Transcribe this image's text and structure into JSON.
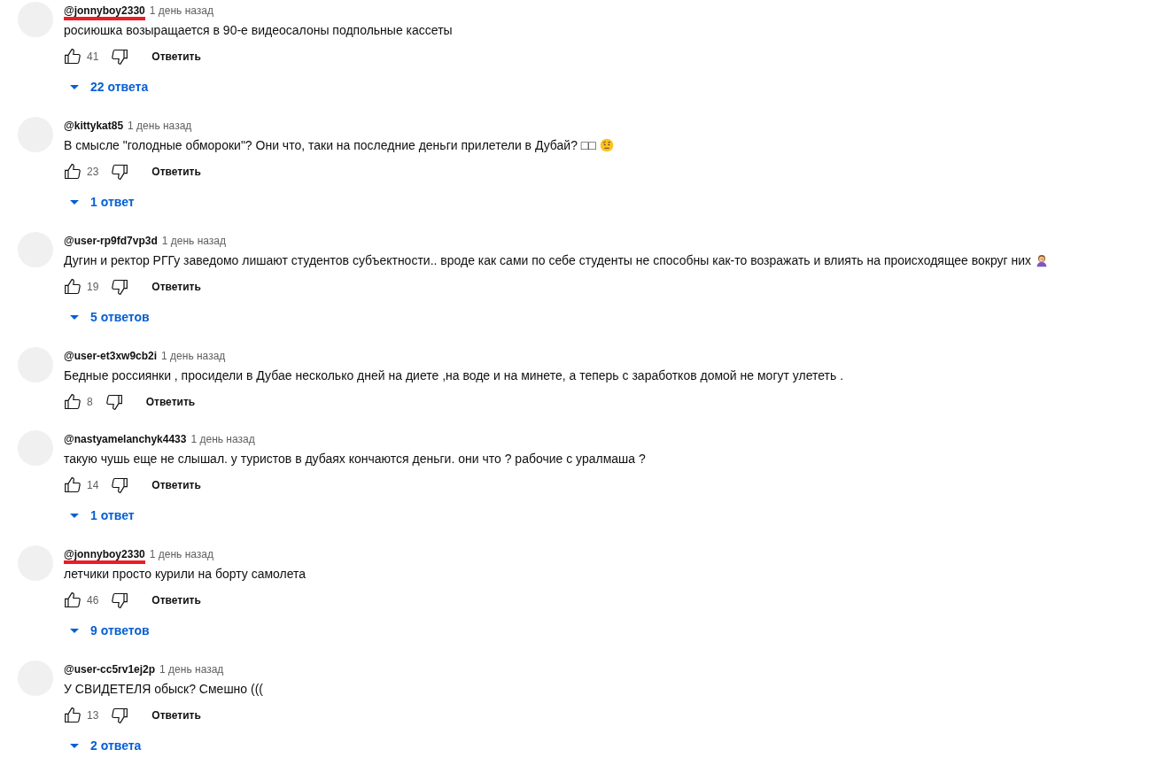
{
  "comments": [
    {
      "kind": "text",
      "author": "@jonnyboy2330",
      "underlined": true,
      "time": "1 день назад",
      "text": "росиюшка возыращается в 90-е видеосалоны подпольные кассеты",
      "likes": "41",
      "reply_label": "Ответить",
      "replies": "22 ответа"
    },
    {
      "kind": "eyebrow",
      "author": "@kittykat85",
      "underlined": false,
      "time": "1 день назад",
      "text": "В смысле \"голодные обмороки\"? Они что, таки на последние деньги прилетели в Дубай? □□",
      "likes": "23",
      "reply_label": "Ответить",
      "replies": "1 ответ"
    },
    {
      "kind": "facepalm",
      "author": "@user-rp9fd7vp3d",
      "underlined": false,
      "time": "1 день назад",
      "text": "Дугин и ректор РГГу заведомо лишают студентов субъектности.. вроде как сами по себе студенты не способны как-то возражать и влиять на происходящее вокруг них",
      "likes": "19",
      "reply_label": "Ответить",
      "replies": "5 ответов"
    },
    {
      "kind": "text",
      "author": "@user-et3xw9cb2i",
      "underlined": false,
      "time": "1 день назад",
      "text": "Бедные россиянки , просидели в Дубае несколько дней на диете ,на воде и на минете, а теперь с заработков домой не могут улететь .",
      "likes": "8",
      "reply_label": "Ответить"
    },
    {
      "kind": "text",
      "author": "@nastyamelanchyk4433",
      "underlined": false,
      "time": "1 день назад",
      "text": "такую чушь еще не слышал. у туристов в дубаях кончаются деньги. они что ? рабочие с уралмаша ?",
      "likes": "14",
      "reply_label": "Ответить",
      "replies": "1 ответ"
    },
    {
      "kind": "text",
      "author": "@jonnyboy2330",
      "underlined": true,
      "time": "1 день назад",
      "text": "летчики просто курили на борту самолета",
      "likes": "46",
      "reply_label": "Ответить",
      "replies": "9 ответов"
    },
    {
      "kind": "text",
      "author": "@user-cc5rv1ej2p",
      "underlined": false,
      "time": "1 день назад",
      "text": "У СВИДЕТЕЛЯ обыск? Смешно (((",
      "likes": "13",
      "reply_label": "Ответить",
      "replies": "2 ответа"
    }
  ]
}
